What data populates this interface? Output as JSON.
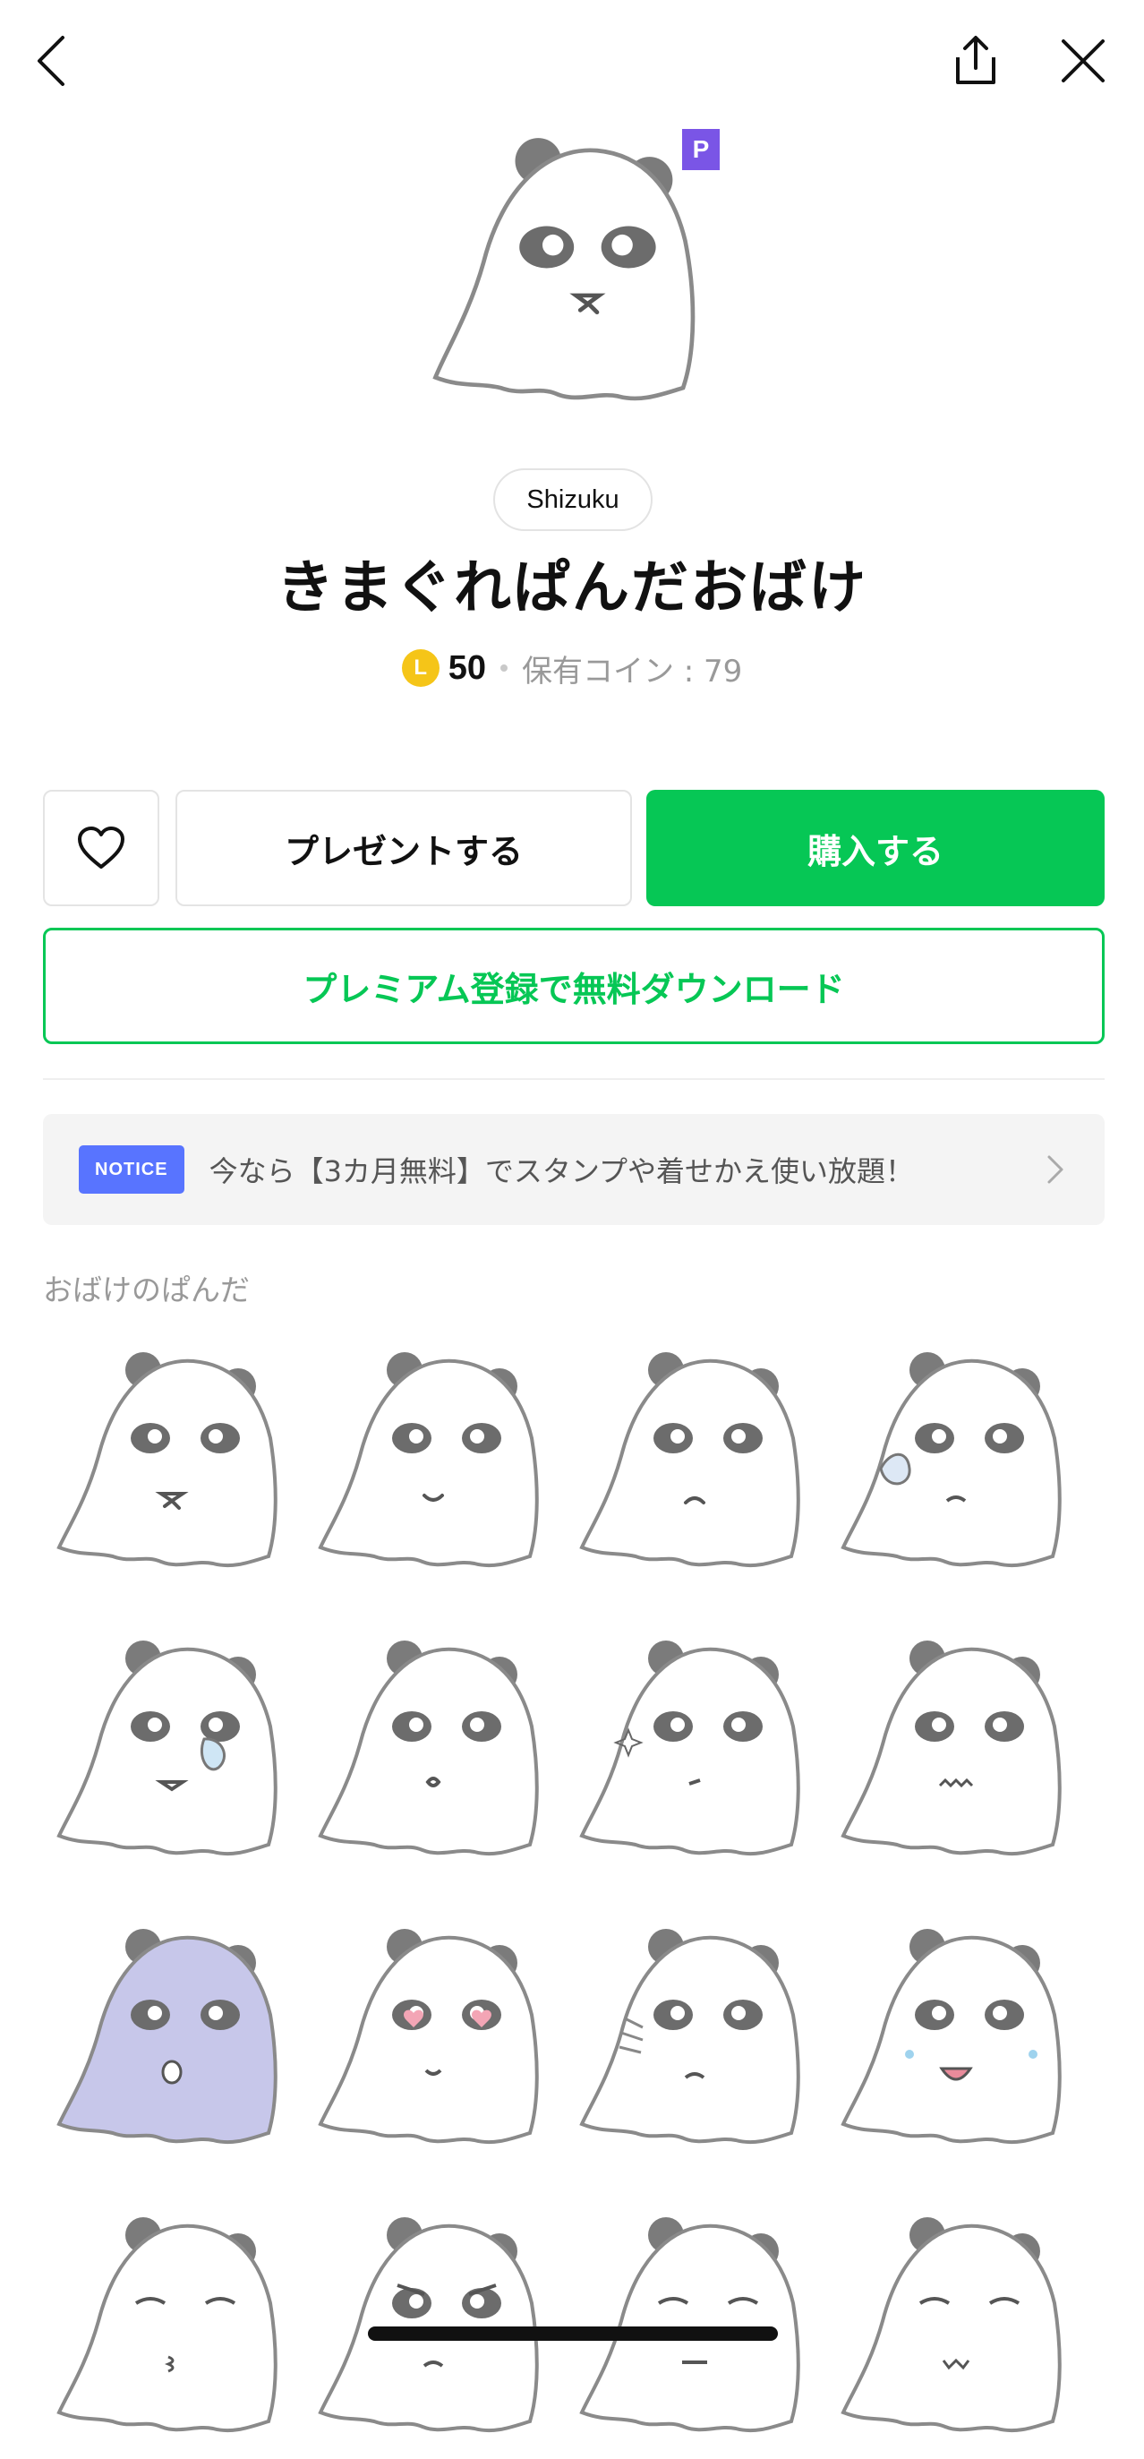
{
  "header": {
    "back_icon": "chevron-left-icon",
    "share_icon": "share-icon",
    "close_icon": "close-icon"
  },
  "product": {
    "premium_badge": "P",
    "author": "Shizuku",
    "title": "きまぐれぱんだおばけ",
    "coin_symbol": "L",
    "price": "50",
    "owned_coins": "保有コイン : 79"
  },
  "actions": {
    "like_icon": "heart-outline-icon",
    "gift_label": "プレゼントする",
    "buy_label": "購入する",
    "premium_label": "プレミアム登録で無料ダウンロード"
  },
  "notice": {
    "badge": "NOTICE",
    "text": "今なら【3カ月無料】でスタンプや着せかえ使い放題！",
    "arrow_icon": "chevron-right-icon"
  },
  "section": {
    "title": "おばけのぱんだ"
  },
  "stickers": [
    {
      "face": "neutral",
      "tint": "#ffffff"
    },
    {
      "face": "smile",
      "tint": "#ffffff"
    },
    {
      "face": "sad",
      "tint": "#ffffff"
    },
    {
      "face": "sweat",
      "tint": "#ffffff"
    },
    {
      "face": "cry",
      "tint": "#ffffff"
    },
    {
      "face": "dizzy",
      "tint": "#ffffff"
    },
    {
      "face": "sparkle",
      "tint": "#ffffff"
    },
    {
      "face": "nervous",
      "tint": "#ffffff"
    },
    {
      "face": "shock",
      "tint": "#c7c7ea"
    },
    {
      "face": "love",
      "tint": "#ffffff"
    },
    {
      "face": "gloomy",
      "tint": "#ffffff"
    },
    {
      "face": "crying-loud",
      "tint": "#ffffff"
    },
    {
      "face": "kiss",
      "tint": "#ffffff"
    },
    {
      "face": "angry",
      "tint": "#ffffff"
    },
    {
      "face": "blank",
      "tint": "#ffffff"
    },
    {
      "face": "content",
      "tint": "#ffffff"
    }
  ],
  "colors": {
    "accent_green": "#06c755",
    "notice_blue": "#5874ff",
    "premium_purple": "#7a55e6",
    "coin_yellow": "#f5c518"
  }
}
